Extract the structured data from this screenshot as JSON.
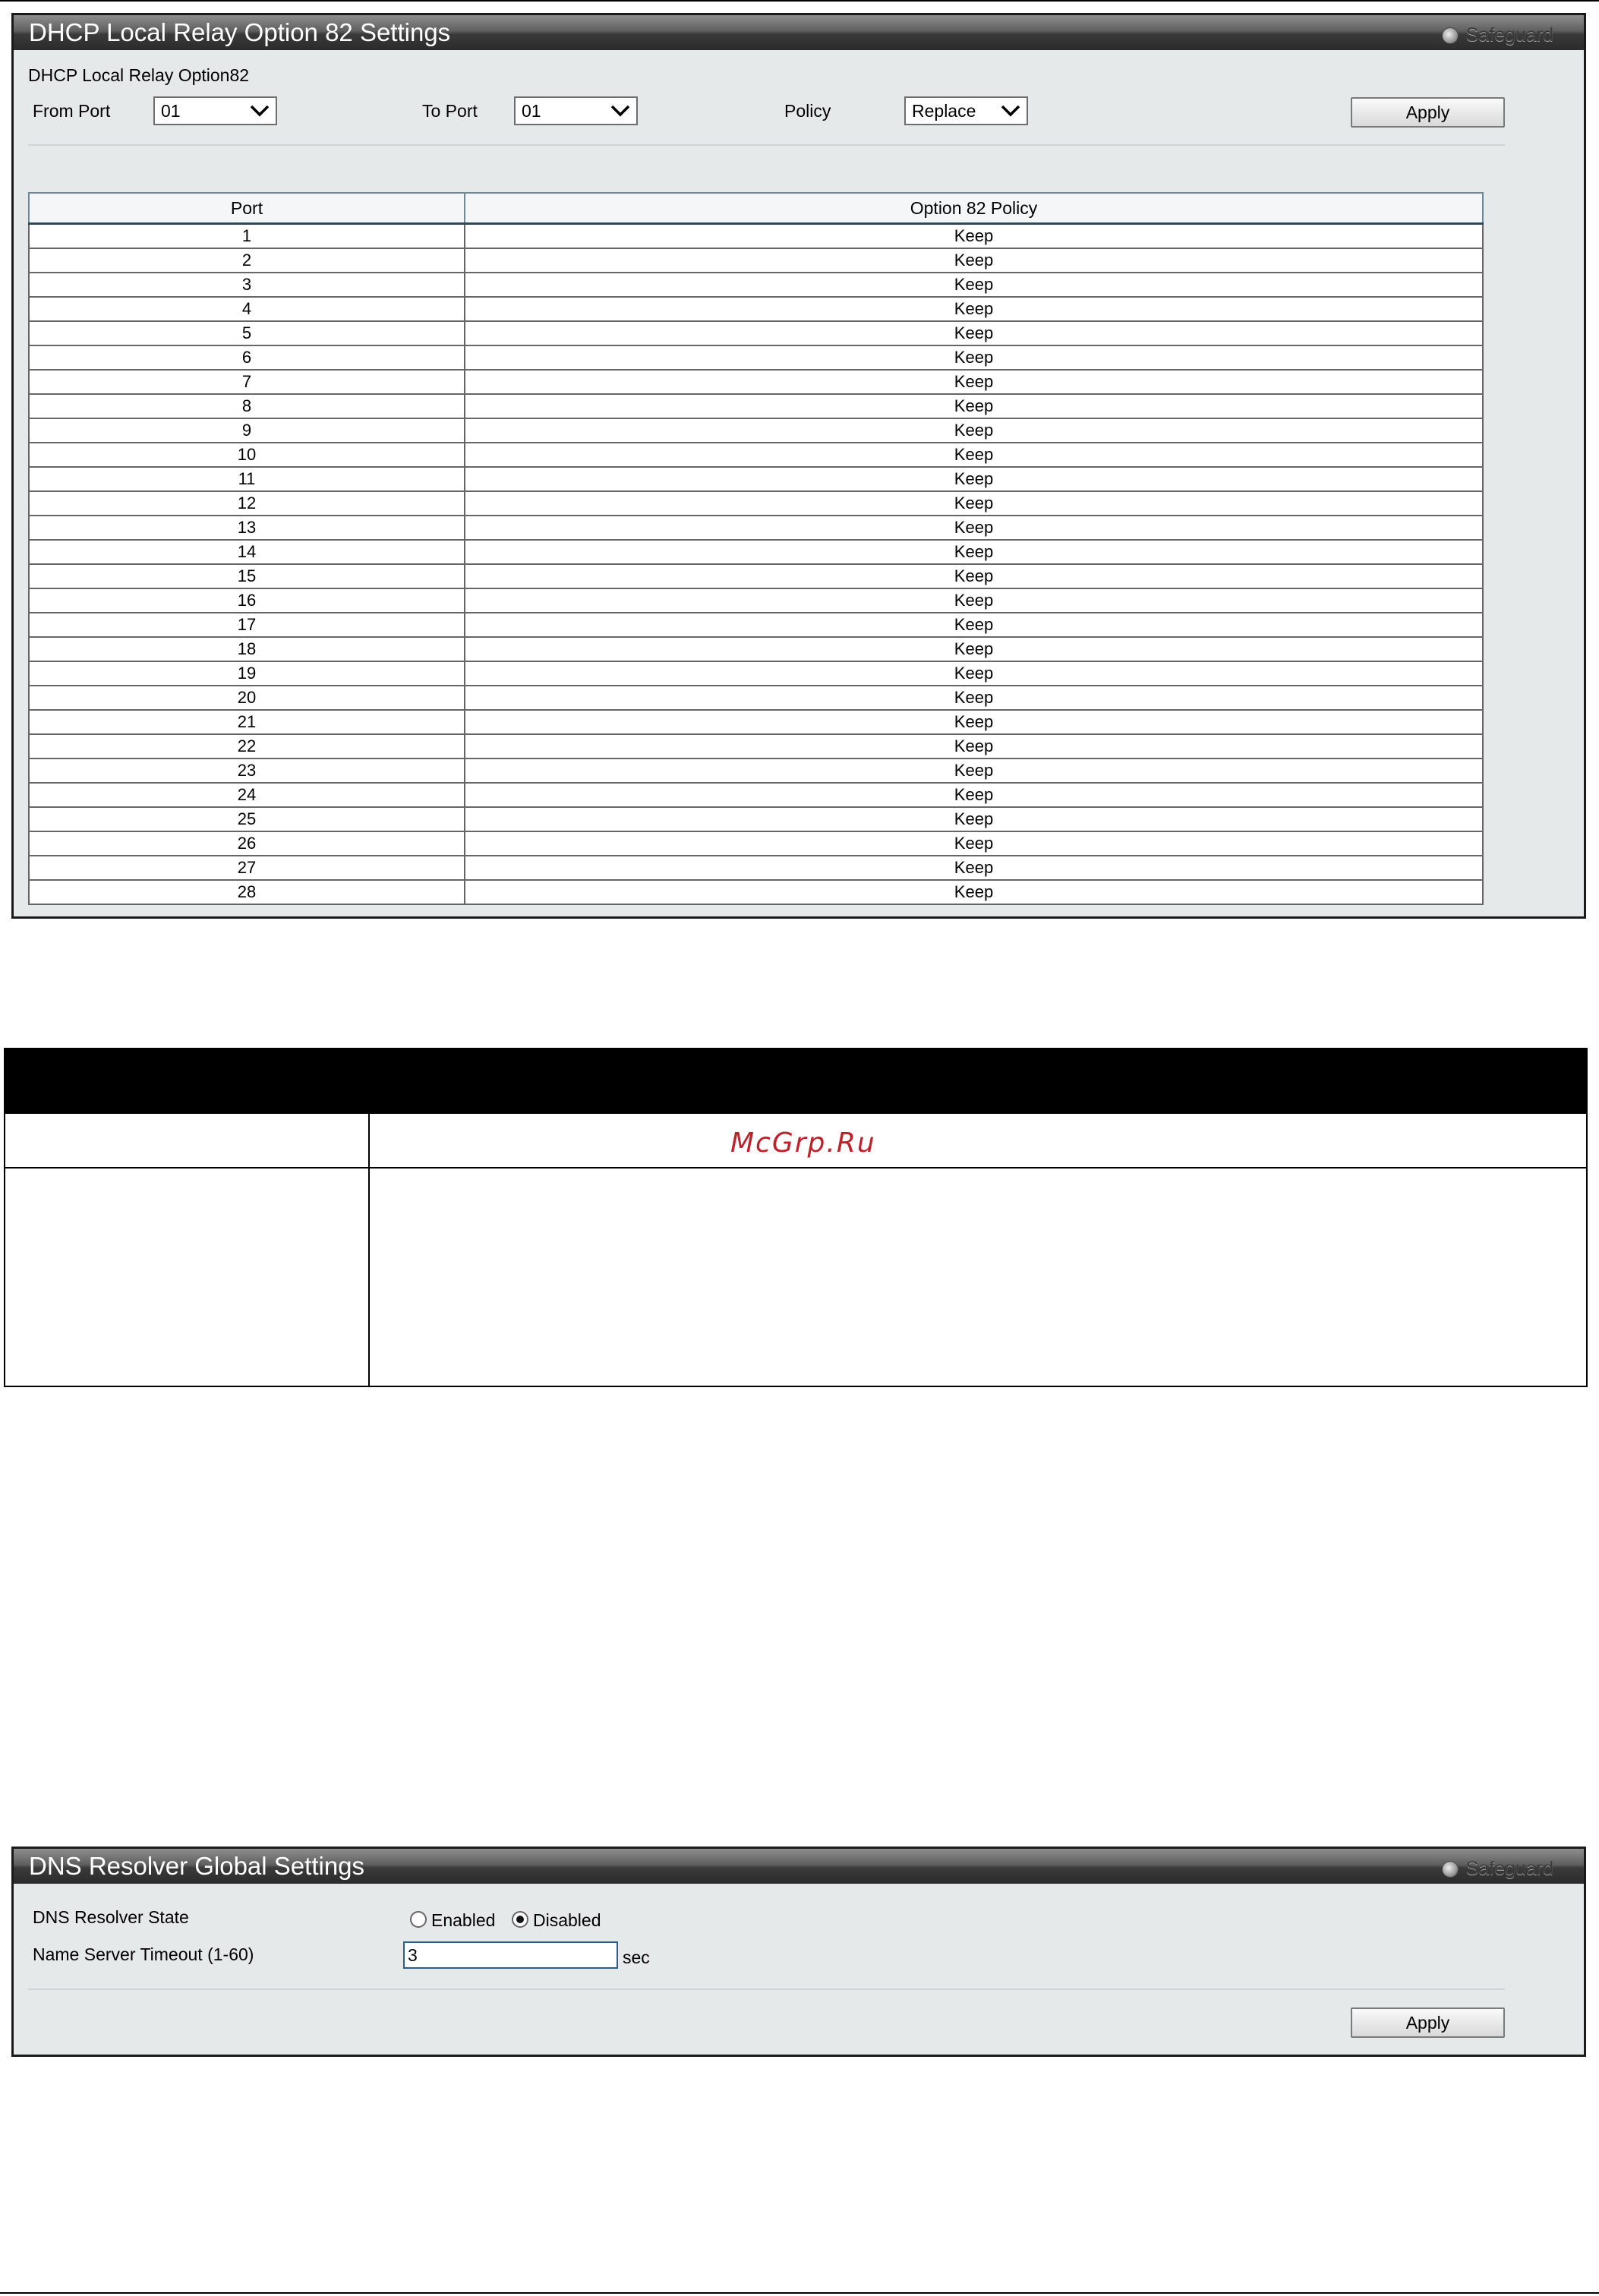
{
  "option82": {
    "title": "DHCP Local Relay Option 82 Settings",
    "safeguard": "Safeguard",
    "section_label": "DHCP Local Relay Option82",
    "from_port_label": "From Port",
    "from_port_value": "01",
    "to_port_label": "To Port",
    "to_port_value": "01",
    "policy_label": "Policy",
    "policy_value": "Replace",
    "apply_label": "Apply",
    "table": {
      "headers": [
        "Port",
        "Option 82 Policy"
      ],
      "rows": [
        [
          "1",
          "Keep"
        ],
        [
          "2",
          "Keep"
        ],
        [
          "3",
          "Keep"
        ],
        [
          "4",
          "Keep"
        ],
        [
          "5",
          "Keep"
        ],
        [
          "6",
          "Keep"
        ],
        [
          "7",
          "Keep"
        ],
        [
          "8",
          "Keep"
        ],
        [
          "9",
          "Keep"
        ],
        [
          "10",
          "Keep"
        ],
        [
          "11",
          "Keep"
        ],
        [
          "12",
          "Keep"
        ],
        [
          "13",
          "Keep"
        ],
        [
          "14",
          "Keep"
        ],
        [
          "15",
          "Keep"
        ],
        [
          "16",
          "Keep"
        ],
        [
          "17",
          "Keep"
        ],
        [
          "18",
          "Keep"
        ],
        [
          "19",
          "Keep"
        ],
        [
          "20",
          "Keep"
        ],
        [
          "21",
          "Keep"
        ],
        [
          "22",
          "Keep"
        ],
        [
          "23",
          "Keep"
        ],
        [
          "24",
          "Keep"
        ],
        [
          "25",
          "Keep"
        ],
        [
          "26",
          "Keep"
        ],
        [
          "27",
          "Keep"
        ],
        [
          "28",
          "Keep"
        ]
      ]
    }
  },
  "watermark": "McGrp.Ru",
  "dns": {
    "title": "DNS Resolver Global Settings",
    "safeguard": "Safeguard",
    "state_label": "DNS Resolver State",
    "enabled_label": "Enabled",
    "disabled_label": "Disabled",
    "selected": "Disabled",
    "timeout_label": "Name Server Timeout (1-60)",
    "timeout_value": "3",
    "timeout_unit": "sec",
    "apply_label": "Apply"
  }
}
